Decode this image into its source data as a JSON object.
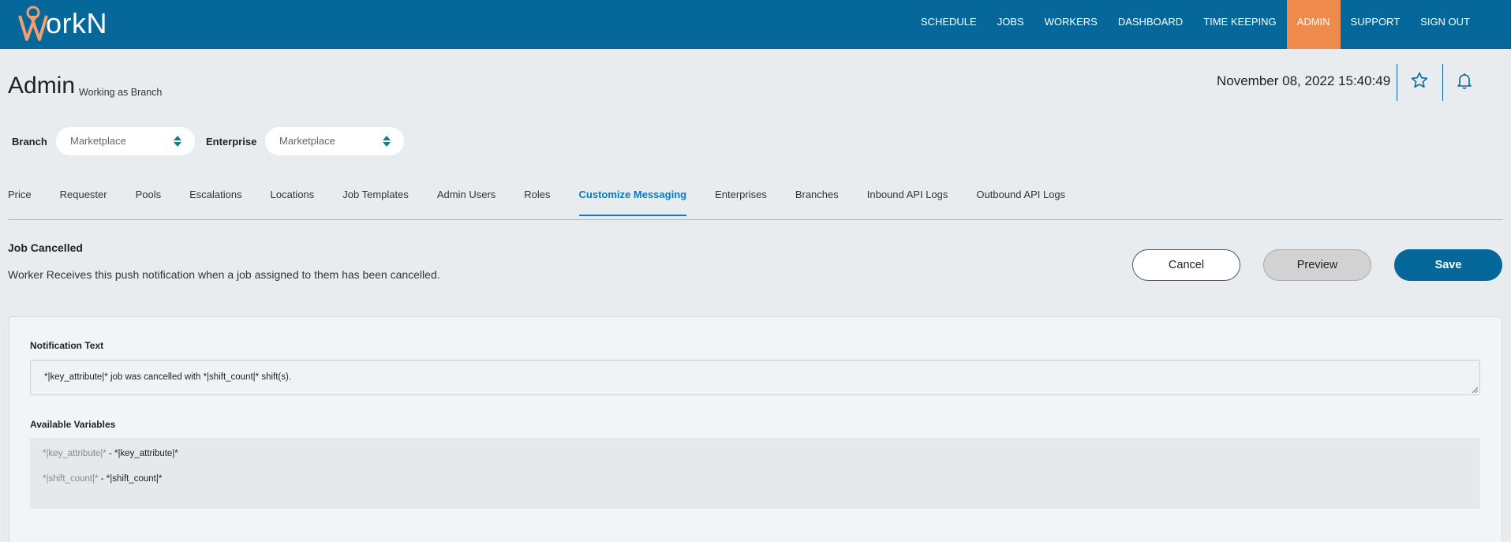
{
  "brand": {
    "logo_text": "orkN",
    "logo_initial": "W",
    "bar_color": "#06679b",
    "active_color": "#ee8a4c"
  },
  "nav": {
    "items": [
      {
        "label": "SCHEDULE"
      },
      {
        "label": "JOBS"
      },
      {
        "label": "WORKERS"
      },
      {
        "label": "DASHBOARD"
      },
      {
        "label": "TIME KEEPING"
      },
      {
        "label": "ADMIN",
        "active": true
      },
      {
        "label": "SUPPORT"
      },
      {
        "label": "SIGN OUT"
      }
    ]
  },
  "header": {
    "title": "Admin",
    "subtitle": "Working as Branch",
    "datetime": "November 08, 2022 15:40:49",
    "icons": [
      "star-icon",
      "bell-icon"
    ]
  },
  "filters": {
    "branch_label": "Branch",
    "branch_value": "Marketplace",
    "enterprise_label": "Enterprise",
    "enterprise_value": "Marketplace"
  },
  "tabs": [
    {
      "label": "Price"
    },
    {
      "label": "Requester"
    },
    {
      "label": "Pools"
    },
    {
      "label": "Escalations"
    },
    {
      "label": "Locations"
    },
    {
      "label": "Job Templates"
    },
    {
      "label": "Admin Users"
    },
    {
      "label": "Roles"
    },
    {
      "label": "Customize Messaging",
      "active": true
    },
    {
      "label": "Enterprises"
    },
    {
      "label": "Branches"
    },
    {
      "label": "Inbound API Logs"
    },
    {
      "label": "Outbound API Logs"
    }
  ],
  "section": {
    "title": "Job Cancelled",
    "description": "Worker Receives this push notification when a job assigned to them has been cancelled."
  },
  "actions": {
    "cancel": "Cancel",
    "preview": "Preview",
    "save": "Save"
  },
  "form": {
    "notification_label": "Notification Text",
    "notification_value": "*|key_attribute|* job was cancelled with *|shift_count|* shift(s).",
    "variables_label": "Available Variables",
    "variables": [
      {
        "key": "*|key_attribute|*",
        "sep": " - ",
        "value": "*|key_attribute|*"
      },
      {
        "key": "*|shift_count|*",
        "sep": " - ",
        "value": "*|shift_count|*"
      }
    ]
  }
}
